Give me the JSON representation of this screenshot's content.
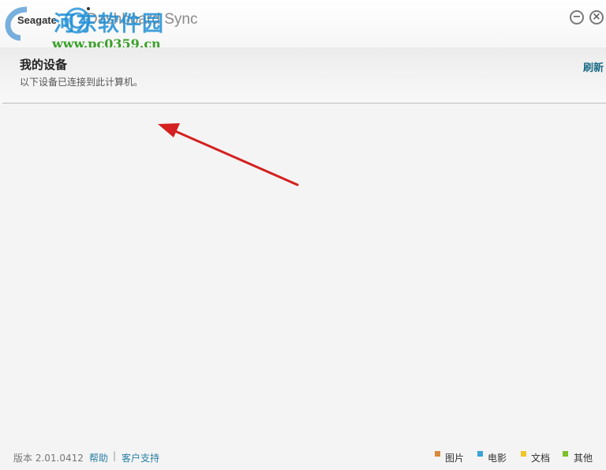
{
  "titlebar": {
    "brand": "Seagate",
    "app_name": "Dashboard Sync",
    "minimize_symbol": "−",
    "close_symbol": "×"
  },
  "watermark": {
    "title": "河东软件园",
    "url": "www.pc0359.cn"
  },
  "header": {
    "title": "我的设备",
    "subtitle": "以下设备已连接到此计算机。",
    "refresh_label": "刷新"
  },
  "footer": {
    "version_label": "版本 2.01.0412",
    "help_label": "帮助",
    "separator": "|",
    "support_label": "客户支持",
    "legend": [
      {
        "label": "图片",
        "color": "#d88a3a"
      },
      {
        "label": "电影",
        "color": "#3aa3d8"
      },
      {
        "label": "文档",
        "color": "#f0c52a"
      },
      {
        "label": "其他",
        "color": "#7cc12a"
      }
    ]
  },
  "colors": {
    "accent_link": "#2a7fa6",
    "refresh": "#1a6c86",
    "annotation_arrow": "#d42020"
  }
}
